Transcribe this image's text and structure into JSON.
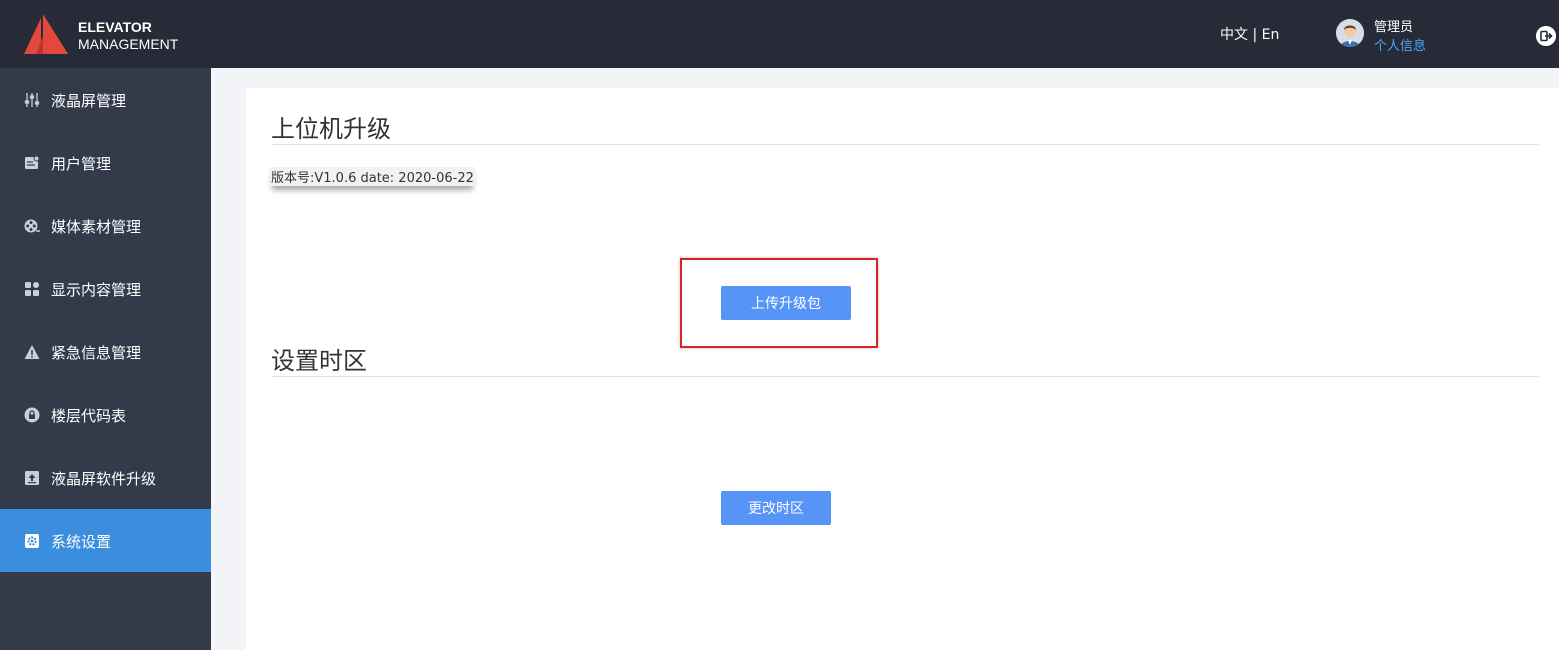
{
  "header": {
    "brand_line1": "ELEVATOR",
    "brand_line2": "MANAGEMENT",
    "lang_zh": "中文",
    "lang_sep": "|",
    "lang_en": "En",
    "user_role": "管理员",
    "user_info_link": "个人信息",
    "logo_color": "#e2483d",
    "logout_icon": "logout-icon"
  },
  "sidebar": {
    "items": [
      {
        "label": "液晶屏管理",
        "icon": "sliders-icon"
      },
      {
        "label": "用户管理",
        "icon": "user-card-icon"
      },
      {
        "label": "媒体素材管理",
        "icon": "film-reel-icon"
      },
      {
        "label": "显示内容管理",
        "icon": "grid-icon"
      },
      {
        "label": "紧急信息管理",
        "icon": "warning-icon"
      },
      {
        "label": "楼层代码表",
        "icon": "lock-icon"
      },
      {
        "label": "液晶屏软件升级",
        "icon": "upload-icon"
      },
      {
        "label": "系统设置",
        "icon": "gear-icon",
        "active": true
      }
    ],
    "active_color": "#3b8ede"
  },
  "main": {
    "upgrade_title": "上位机升级",
    "version_text": "版本号:V1.0.6 date: 2020-06-22",
    "upload_button": "上传升级包",
    "timezone_title": "设置时区",
    "timezone_button": "更改时区",
    "button_color": "#5794f7",
    "highlight_color": "#d0272b"
  }
}
